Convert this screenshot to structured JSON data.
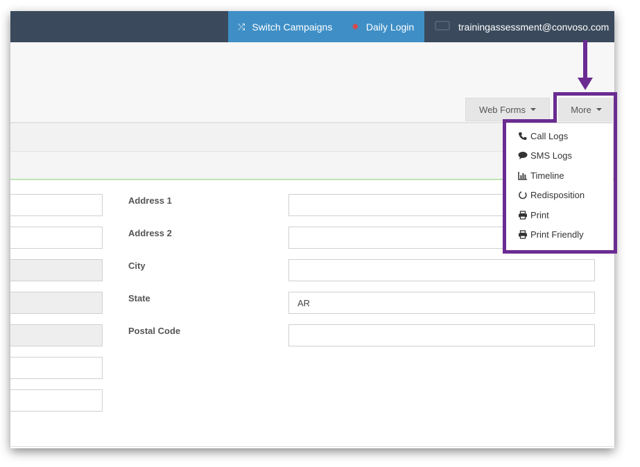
{
  "topbar": {
    "switch_campaigns": "Switch Campaigns",
    "daily_login": "Daily Login",
    "user_email": "trainingassessment@convoso.com"
  },
  "toolbar": {
    "web_forms": "Web Forms",
    "more": "More"
  },
  "more_menu": {
    "items": [
      {
        "label": "Call Logs",
        "icon": "phone-icon"
      },
      {
        "label": "SMS Logs",
        "icon": "chat-bubble-icon"
      },
      {
        "label": "Timeline",
        "icon": "bar-chart-icon"
      },
      {
        "label": "Redisposition",
        "icon": "circle-refresh-icon"
      },
      {
        "label": "Print",
        "icon": "printer-icon"
      },
      {
        "label": "Print Friendly",
        "icon": "printer-icon"
      }
    ]
  },
  "form": {
    "address1_label": "Address 1",
    "address2_label": "Address 2",
    "city_label": "City",
    "state_label": "State",
    "state_value": "AR",
    "postal_code_label": "Postal Code"
  },
  "colors": {
    "topbar_bg": "#3a4a5c",
    "switch_bg": "#3f8fc6",
    "highlight": "#6a2c91"
  }
}
